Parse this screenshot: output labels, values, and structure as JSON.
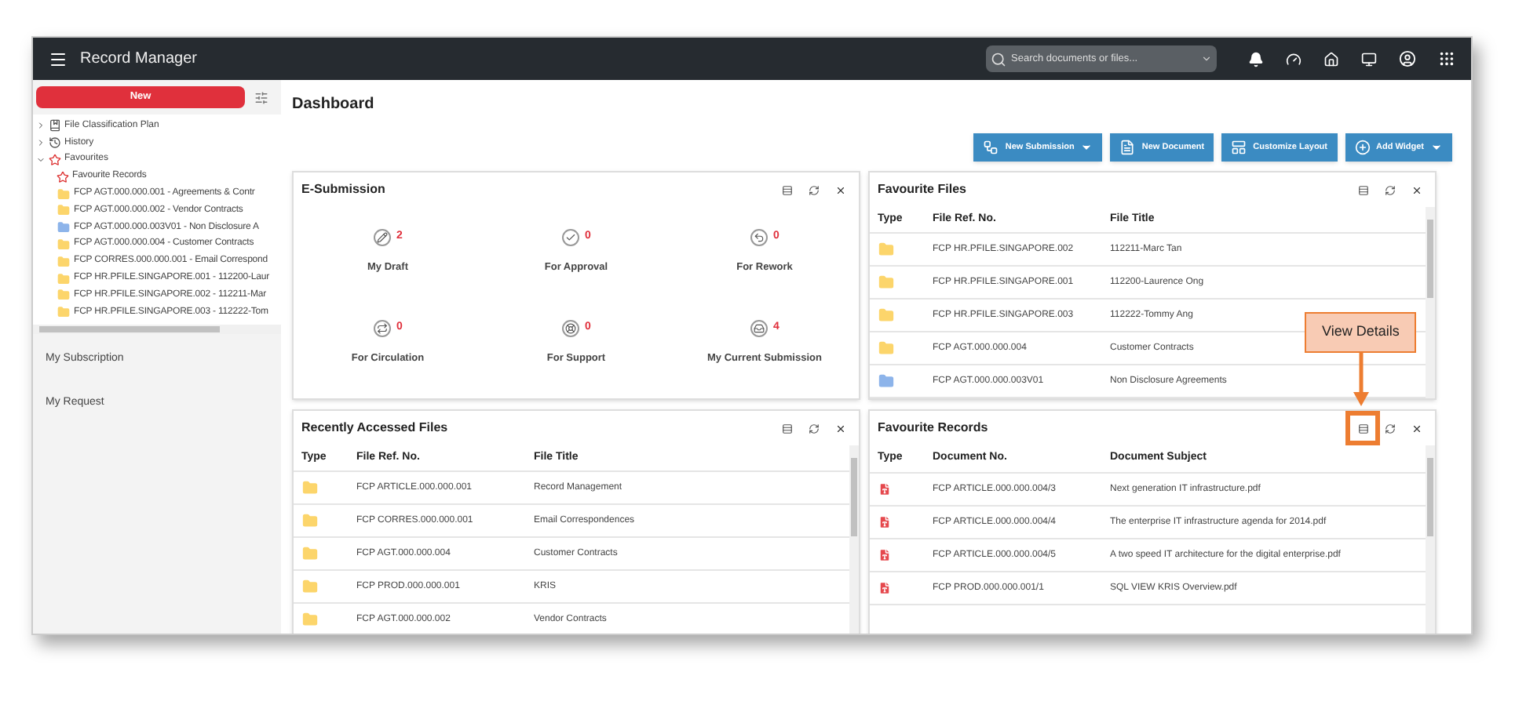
{
  "app_bar": {
    "title": "Record Manager",
    "search": {
      "placeholder": "Search documents or files..."
    }
  },
  "sidebar": {
    "new_button": "New",
    "tree": [
      {
        "label": "File Classification Plan",
        "kind": "book",
        "expanded": false
      },
      {
        "label": "History",
        "kind": "history",
        "expanded": false
      },
      {
        "label": "Favourites",
        "kind": "star",
        "expanded": true,
        "children": [
          {
            "label": "Favourite Records",
            "kind": "star"
          },
          {
            "label": "FCP AGT.000.000.001 - Agreements & Contr",
            "kind": "folder",
            "color": "#fcd56b"
          },
          {
            "label": "FCP AGT.000.000.002 - Vendor Contracts",
            "kind": "folder",
            "color": "#fcd56b"
          },
          {
            "label": "FCP AGT.000.000.003V01 - Non Disclosure A",
            "kind": "folder",
            "color": "#8db4ea"
          },
          {
            "label": "FCP AGT.000.000.004 - Customer Contracts",
            "kind": "folder",
            "color": "#fcd56b"
          },
          {
            "label": "FCP CORRES.000.000.001 - Email Correspond",
            "kind": "folder",
            "color": "#fcd56b"
          },
          {
            "label": "FCP HR.PFILE.SINGAPORE.001 - 112200-Laur",
            "kind": "folder",
            "color": "#fcd56b"
          },
          {
            "label": "FCP HR.PFILE.SINGAPORE.002 - 112211-Mar",
            "kind": "folder",
            "color": "#fcd56b"
          },
          {
            "label": "FCP HR.PFILE.SINGAPORE.003 - 112222-Tom",
            "kind": "folder",
            "color": "#fcd56b"
          }
        ]
      }
    ],
    "links": [
      "My Subscription",
      "My Request"
    ]
  },
  "page_title": "Dashboard",
  "toolbar": [
    {
      "label": "New Submission",
      "kind": "submission",
      "dropdown": true
    },
    {
      "label": "New Document",
      "kind": "document",
      "dropdown": false
    },
    {
      "label": "Customize Layout",
      "kind": "layout",
      "dropdown": false
    },
    {
      "label": "Add Widget",
      "kind": "widget",
      "dropdown": true
    }
  ],
  "e_submission": {
    "title": "E-Submission",
    "highlighted": false,
    "stats": [
      {
        "label": "My Draft",
        "count": "2",
        "kind": "draft"
      },
      {
        "label": "For Approval",
        "count": "0",
        "kind": "approval"
      },
      {
        "label": "For Rework",
        "count": "0",
        "kind": "rework"
      },
      {
        "label": "For Circulation",
        "count": "0",
        "kind": "circulation"
      },
      {
        "label": "For Support",
        "count": "0",
        "kind": "support"
      },
      {
        "label": "My Current Submission",
        "count": "4",
        "kind": "submission"
      }
    ]
  },
  "favourite_files": {
    "title": "Favourite Files",
    "highlighted": false,
    "columns": [
      "Type",
      "File Ref. No.",
      "File Title"
    ],
    "rows": [
      {
        "ref": "FCP HR.PFILE.SINGAPORE.002",
        "title": "112211-Marc Tan",
        "color": "#fcd56b"
      },
      {
        "ref": "FCP HR.PFILE.SINGAPORE.001",
        "title": "112200-Laurence Ong",
        "color": "#fcd56b"
      },
      {
        "ref": "FCP HR.PFILE.SINGAPORE.003",
        "title": "112222-Tommy Ang",
        "color": "#fcd56b"
      },
      {
        "ref": "FCP AGT.000.000.004",
        "title": "Customer Contracts",
        "color": "#fcd56b"
      },
      {
        "ref": "FCP AGT.000.000.003V01",
        "title": "Non Disclosure Agreements",
        "color": "#8db4ea"
      }
    ]
  },
  "recently_accessed": {
    "title": "Recently Accessed Files",
    "highlighted": false,
    "columns": [
      "Type",
      "File Ref. No.",
      "File Title"
    ],
    "rows": [
      {
        "ref": "FCP ARTICLE.000.000.001",
        "title": "Record Management"
      },
      {
        "ref": "FCP CORRES.000.000.001",
        "title": "Email Correspondences"
      },
      {
        "ref": "FCP AGT.000.000.004",
        "title": "Customer Contracts"
      },
      {
        "ref": "FCP PROD.000.000.001",
        "title": "KRIS"
      },
      {
        "ref": "FCP AGT.000.000.002",
        "title": "Vendor Contracts"
      }
    ]
  },
  "favourite_records": {
    "title": "Favourite Records",
    "highlighted": true,
    "columns": [
      "Type",
      "Document No.",
      "Document Subject"
    ],
    "rows": [
      {
        "ref": "FCP ARTICLE.000.000.004/3",
        "title": "Next generation IT infrastructure.pdf"
      },
      {
        "ref": "FCP ARTICLE.000.000.004/4",
        "title": "The enterprise IT infrastructure agenda for 2014.pdf"
      },
      {
        "ref": "FCP ARTICLE.000.000.004/5",
        "title": "A two speed IT architecture for the digital enterprise.pdf"
      },
      {
        "ref": "FCP PROD.000.000.001/1",
        "title": "SQL VIEW KRIS Overview.pdf"
      }
    ]
  },
  "callout": {
    "text": "View Details"
  }
}
